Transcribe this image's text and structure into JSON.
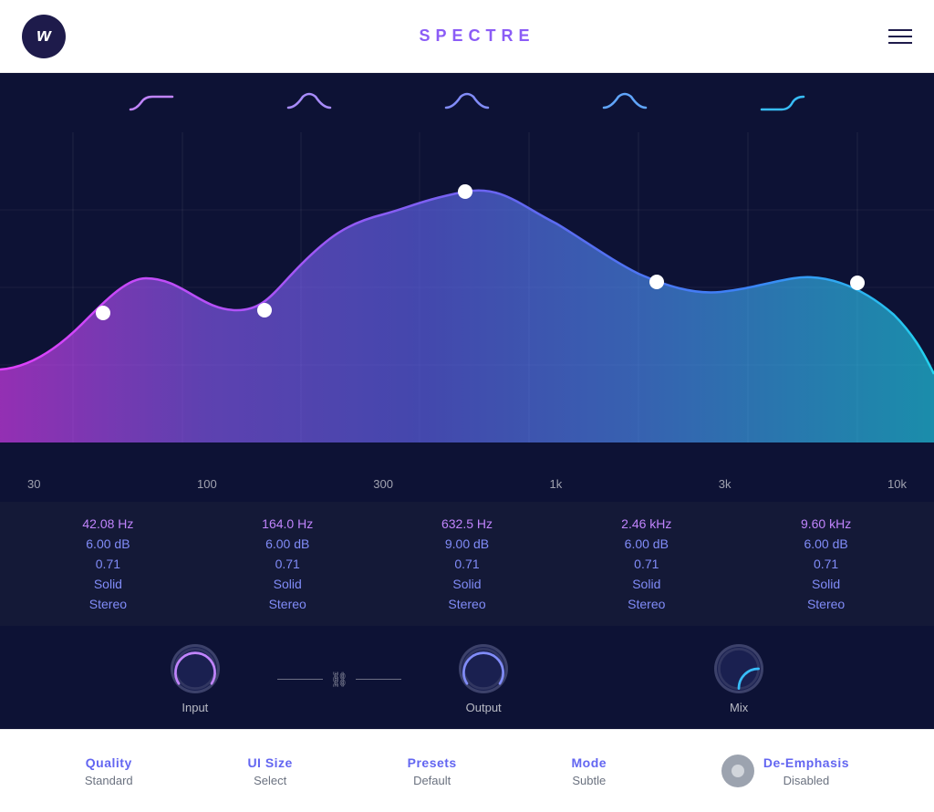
{
  "header": {
    "logo_letter": "w",
    "title": "SPECTRE"
  },
  "filter_icons": [
    {
      "name": "low-shelf",
      "symbol": "⌇",
      "svg_path": "lowshelf"
    },
    {
      "name": "bell1",
      "symbol": "∩",
      "svg_path": "bell"
    },
    {
      "name": "bell2",
      "symbol": "∩",
      "svg_path": "bell"
    },
    {
      "name": "bell3",
      "symbol": "∩",
      "svg_path": "bell"
    },
    {
      "name": "high-shelf",
      "symbol": "⌇",
      "svg_path": "highshelf"
    }
  ],
  "freq_labels": [
    "30",
    "100",
    "300",
    "1k",
    "3k",
    "10k"
  ],
  "bands": [
    {
      "freq": "42.08 Hz",
      "gain": "6.00 dB",
      "q": "0.71",
      "type": "Solid",
      "channel": "Stereo",
      "color": "#c084fc"
    },
    {
      "freq": "164.0 Hz",
      "gain": "6.00 dB",
      "q": "0.71",
      "type": "Solid",
      "channel": "Stereo",
      "color": "#818cf8"
    },
    {
      "freq": "632.5 Hz",
      "gain": "9.00 dB",
      "q": "0.71",
      "type": "Solid",
      "channel": "Stereo",
      "color": "#818cf8"
    },
    {
      "freq": "2.46 kHz",
      "gain": "6.00 dB",
      "q": "0.71",
      "type": "Solid",
      "channel": "Stereo",
      "color": "#818cf8"
    },
    {
      "freq": "9.60 kHz",
      "gain": "6.00 dB",
      "q": "0.71",
      "type": "Solid",
      "channel": "Stereo",
      "color": "#818cf8"
    }
  ],
  "knobs": {
    "input_label": "Input",
    "output_label": "Output",
    "mix_label": "Mix",
    "input_color": "#c084fc",
    "output_color": "#818cf8",
    "mix_color": "#38bdf8"
  },
  "bottom": {
    "quality_label": "Quality",
    "quality_value": "Standard",
    "ui_size_label": "UI Size",
    "ui_size_value": "Select",
    "presets_label": "Presets",
    "presets_value": "Default",
    "mode_label": "Mode",
    "mode_value": "Subtle",
    "de_emphasis_label": "De-Emphasis",
    "de_emphasis_value": "Disabled"
  }
}
